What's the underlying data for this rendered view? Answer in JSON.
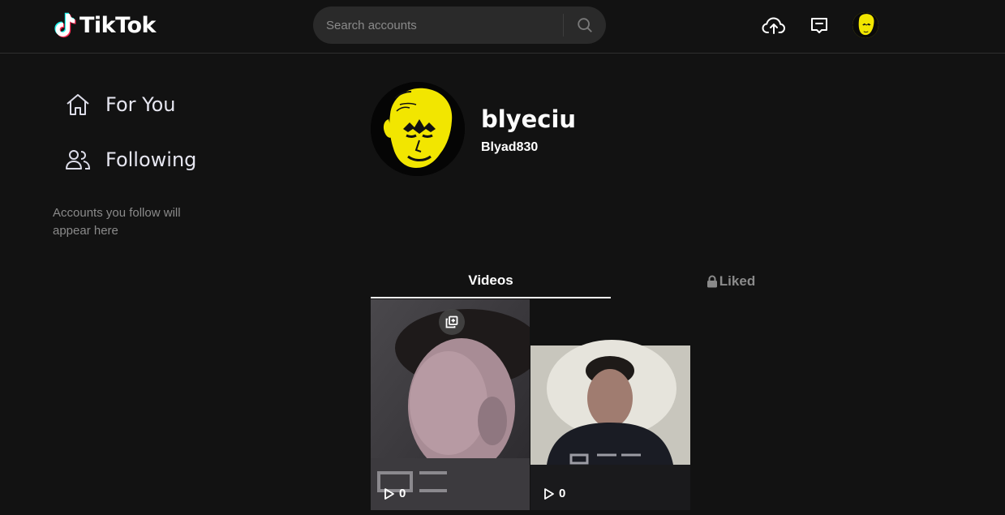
{
  "header": {
    "logo_text": "TikTok",
    "search_placeholder": "Search accounts",
    "icons": [
      "upload-icon",
      "inbox-icon",
      "search-icon"
    ]
  },
  "sidebar": {
    "items": [
      {
        "label": "For You",
        "icon": "home-icon"
      },
      {
        "label": "Following",
        "icon": "people-icon"
      }
    ],
    "note": "Accounts you follow will appear here"
  },
  "profile": {
    "username": "blyeciu",
    "nickname": "Blyad830"
  },
  "tabs": [
    {
      "label": "Videos",
      "active": true
    },
    {
      "label": "Liked",
      "active": false,
      "locked": true
    }
  ],
  "videos": [
    {
      "views": "0",
      "multi": true
    },
    {
      "views": "0",
      "multi": false
    }
  ],
  "colors": {
    "background": "#121212",
    "avatar_yellow": "#f2e600",
    "muted_text": "#8a8a8a"
  }
}
